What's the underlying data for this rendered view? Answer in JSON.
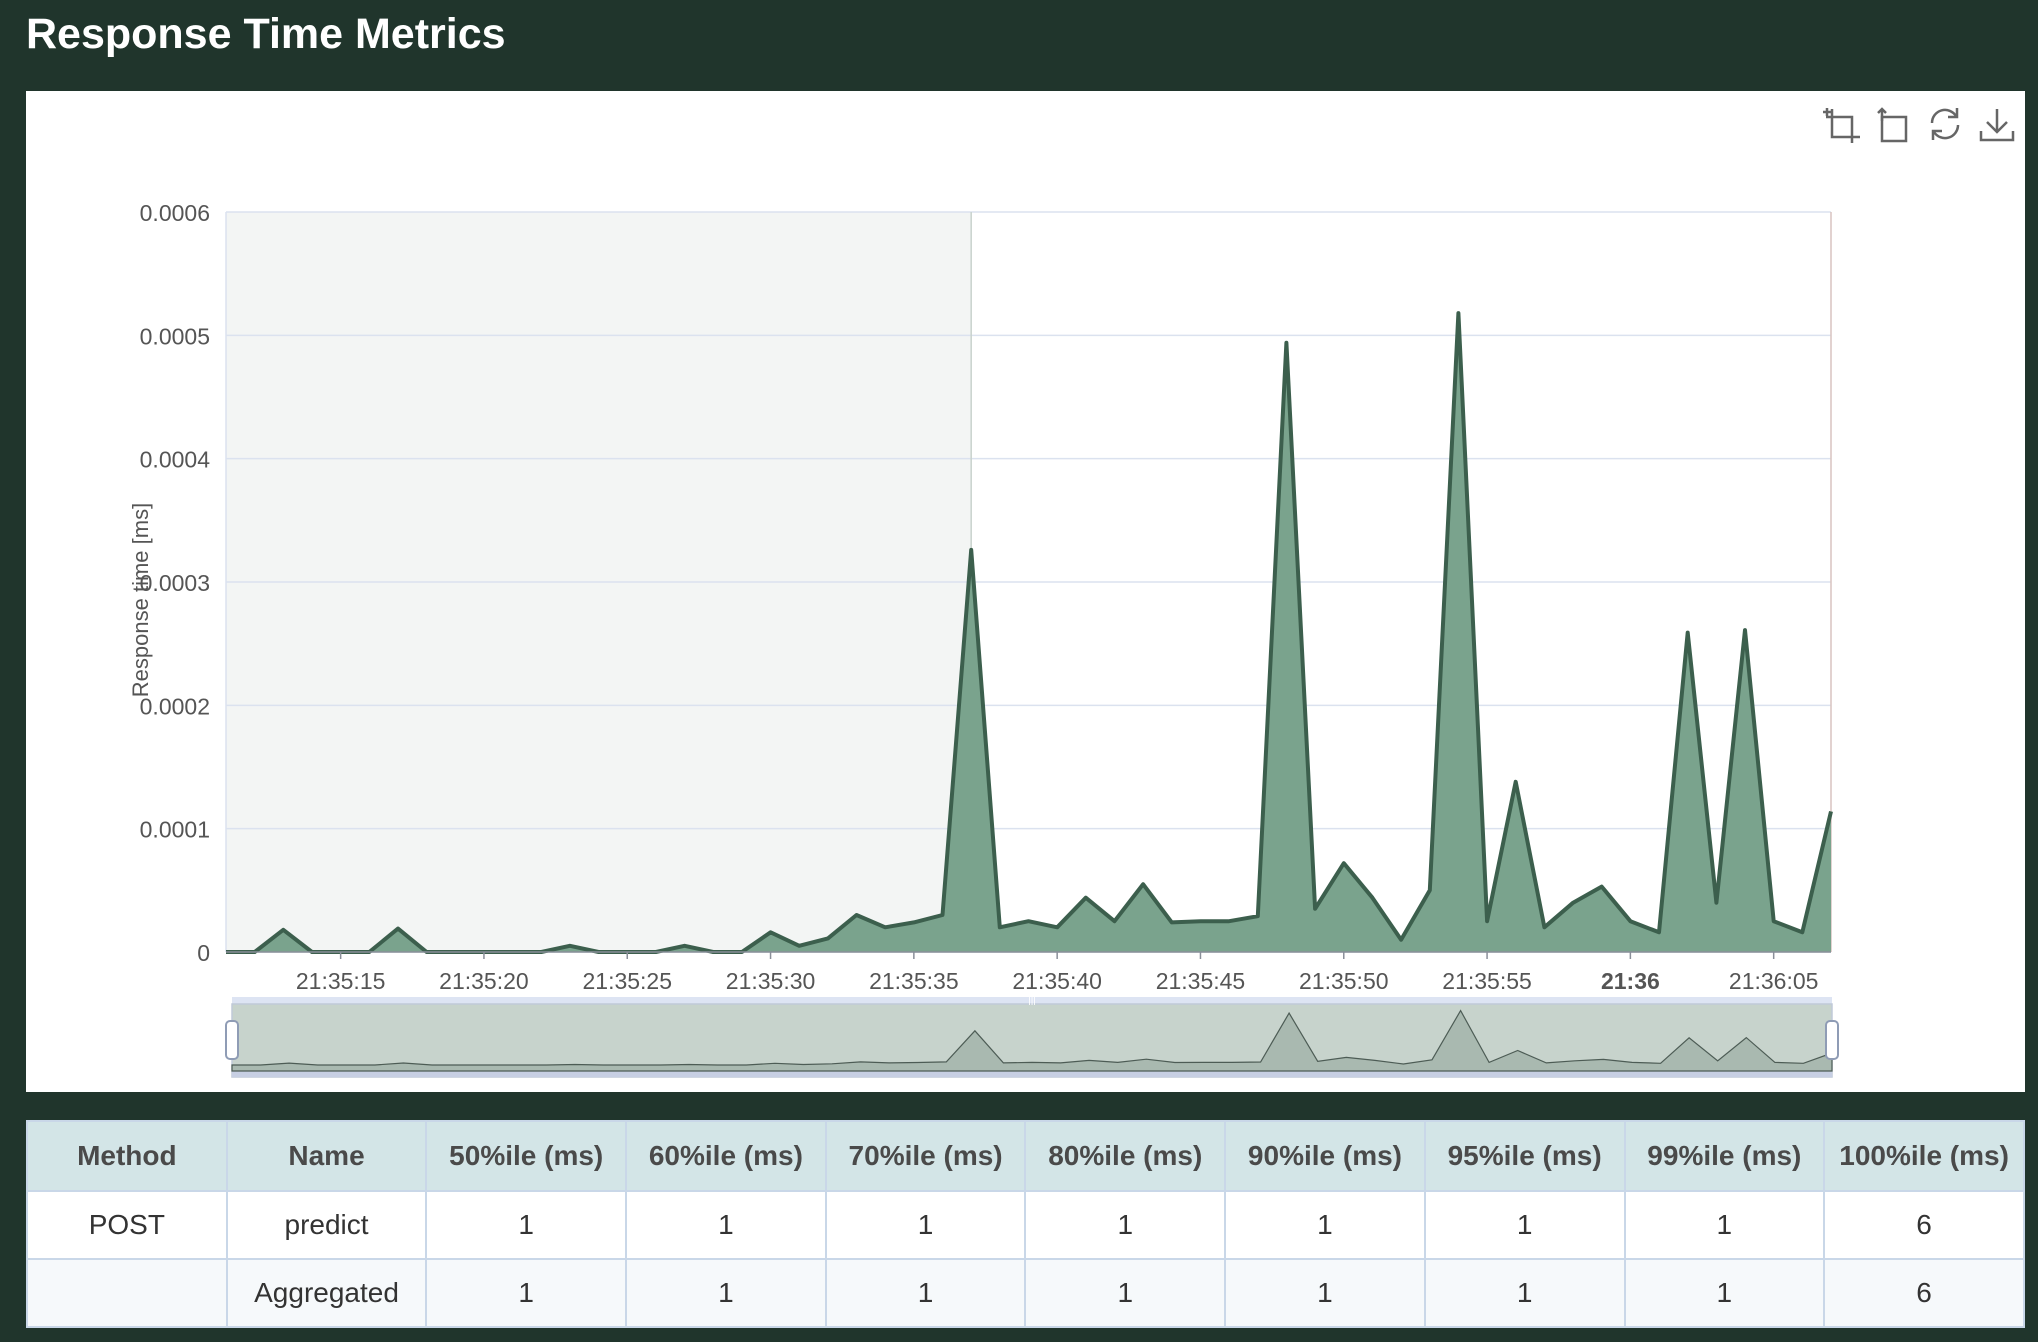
{
  "page": {
    "title": "Response Time Metrics"
  },
  "toolbar": {
    "icons": [
      "zoom-select-icon",
      "zoom-reset-icon",
      "refresh-icon",
      "download-icon"
    ]
  },
  "colors": {
    "background": "#20352c",
    "series_line": "#3c5f4d",
    "series_fill": "#7aa38d",
    "grid": "#dbe2ef",
    "header_bg": "#d3e5e7"
  },
  "chart_data": {
    "type": "area",
    "title": "",
    "ylabel": "Response time [ms]",
    "ylim": [
      0,
      0.0006
    ],
    "yticks": [
      "0",
      "0.0001",
      "0.0002",
      "0.0003",
      "0.0004",
      "0.0005",
      "0.0006"
    ],
    "xticks": [
      "21:35:15",
      "21:35:20",
      "21:35:25",
      "21:35:30",
      "21:35:35",
      "21:35:40",
      "21:35:45",
      "21:35:50",
      "21:35:55",
      "21:36",
      "21:36:05"
    ],
    "xlim": [
      "21:35:11",
      "21:36:07"
    ],
    "grid": true,
    "series": [
      {
        "values": [
          [
            "21:35:11",
            0
          ],
          [
            "21:35:12",
            0
          ],
          [
            "21:35:13",
            1.8e-05
          ],
          [
            "21:35:14",
            0
          ],
          [
            "21:35:15",
            0
          ],
          [
            "21:35:16",
            0
          ],
          [
            "21:35:17",
            1.9e-05
          ],
          [
            "21:35:18",
            0
          ],
          [
            "21:35:19",
            0
          ],
          [
            "21:35:20",
            0
          ],
          [
            "21:35:21",
            0
          ],
          [
            "21:35:22",
            0
          ],
          [
            "21:35:23",
            5e-06
          ],
          [
            "21:35:24",
            0
          ],
          [
            "21:35:25",
            0
          ],
          [
            "21:35:26",
            0
          ],
          [
            "21:35:27",
            5e-06
          ],
          [
            "21:35:28",
            0
          ],
          [
            "21:35:29",
            0
          ],
          [
            "21:35:30",
            1.6e-05
          ],
          [
            "21:35:31",
            5e-06
          ],
          [
            "21:35:32",
            1.1e-05
          ],
          [
            "21:35:33",
            3e-05
          ],
          [
            "21:35:34",
            2e-05
          ],
          [
            "21:35:35",
            2.4e-05
          ],
          [
            "21:35:36",
            3e-05
          ],
          [
            "21:35:37",
            0.000326
          ],
          [
            "21:35:38",
            2e-05
          ],
          [
            "21:35:39",
            2.5e-05
          ],
          [
            "21:35:40",
            2e-05
          ],
          [
            "21:35:41",
            4.4e-05
          ],
          [
            "21:35:42",
            2.5e-05
          ],
          [
            "21:35:43",
            5.5e-05
          ],
          [
            "21:35:44",
            2.4e-05
          ],
          [
            "21:35:45",
            2.5e-05
          ],
          [
            "21:35:46",
            2.5e-05
          ],
          [
            "21:35:47",
            2.9e-05
          ],
          [
            "21:35:48",
            0.000494
          ],
          [
            "21:35:49",
            3.5e-05
          ],
          [
            "21:35:50",
            7.2e-05
          ],
          [
            "21:35:51",
            4.4e-05
          ],
          [
            "21:35:52",
            1e-05
          ],
          [
            "21:35:53",
            5e-05
          ],
          [
            "21:35:54",
            0.000518
          ],
          [
            "21:35:55",
            2.5e-05
          ],
          [
            "21:35:56",
            0.000138
          ],
          [
            "21:35:57",
            2e-05
          ],
          [
            "21:35:58",
            4e-05
          ],
          [
            "21:35:59",
            5.3e-05
          ],
          [
            "21:36:00",
            2.5e-05
          ],
          [
            "21:36:01",
            1.6e-05
          ],
          [
            "21:36:02",
            0.000259
          ],
          [
            "21:36:03",
            4e-05
          ],
          [
            "21:36:04",
            0.000261
          ],
          [
            "21:36:05",
            2.5e-05
          ],
          [
            "21:36:06",
            1.6e-05
          ],
          [
            "21:36:07",
            0.000114
          ]
        ]
      }
    ],
    "highlight_band": [
      "21:35:11",
      "21:35:37"
    ]
  },
  "table": {
    "columns": [
      "Method",
      "Name",
      "50%ile (ms)",
      "60%ile (ms)",
      "70%ile (ms)",
      "80%ile (ms)",
      "90%ile (ms)",
      "95%ile (ms)",
      "99%ile (ms)",
      "100%ile (ms)"
    ],
    "rows": [
      [
        "POST",
        "predict",
        "1",
        "1",
        "1",
        "1",
        "1",
        "1",
        "1",
        "6"
      ],
      [
        "",
        "Aggregated",
        "1",
        "1",
        "1",
        "1",
        "1",
        "1",
        "1",
        "6"
      ]
    ]
  }
}
